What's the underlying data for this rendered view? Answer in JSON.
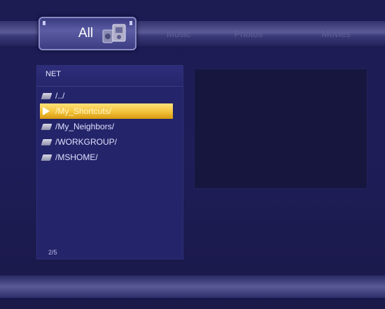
{
  "tabs": {
    "all": "All",
    "music": "Music",
    "photos": "Photos",
    "movies": "Movies"
  },
  "panel": {
    "title": "NET",
    "items": [
      {
        "label": "/../",
        "selected": false
      },
      {
        "label": "/My_Shortcuts/",
        "selected": true
      },
      {
        "label": "/My_Neighbors/",
        "selected": false
      },
      {
        "label": "/WORKGROUP/",
        "selected": false
      },
      {
        "label": "/MSHOME/",
        "selected": false
      }
    ],
    "page_indicator": "2/5"
  },
  "colors": {
    "background": "#1c1b52",
    "selection": "#f2c23a",
    "panel": "#24246a",
    "preview": "#17163f"
  },
  "icons": {
    "all_tab": "media-collection-icon",
    "folder": "folder-icon",
    "selection": "selection-pointer-icon"
  }
}
